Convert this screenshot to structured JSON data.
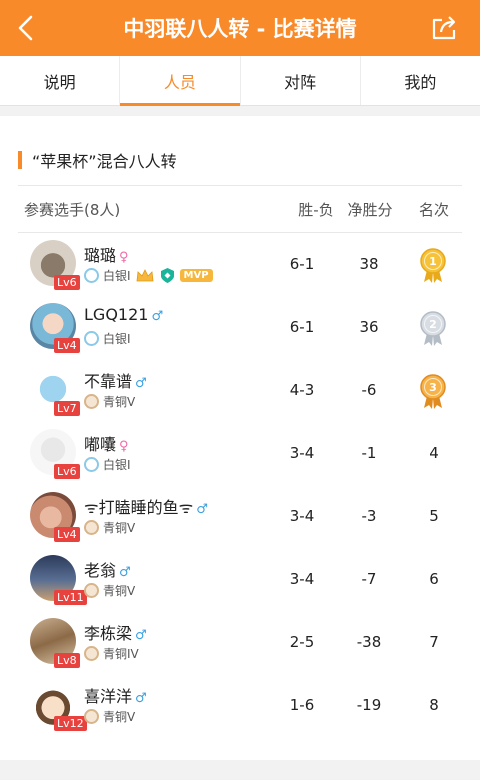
{
  "header": {
    "title": "中羽联八人转 - 比赛详情"
  },
  "tabs": [
    {
      "label": "说明"
    },
    {
      "label": "人员"
    },
    {
      "label": "对阵"
    },
    {
      "label": "我的"
    }
  ],
  "section": {
    "title": "“苹果杯”混合八人转"
  },
  "table": {
    "headers": {
      "player": "参赛选手(8人)",
      "wl": "胜-负",
      "net": "净胜分",
      "rank": "名次"
    },
    "rows": [
      {
        "name": "璐璐",
        "gender": "♀",
        "level": "Lv6",
        "tier": "白银I",
        "wl": "6-1",
        "net": "38",
        "rank": "1"
      },
      {
        "name": "LGQ121",
        "gender": "♂",
        "level": "Lv4",
        "tier": "白银I",
        "wl": "6-1",
        "net": "36",
        "rank": "2"
      },
      {
        "name": "不靠谱",
        "gender": "♂",
        "level": "Lv7",
        "tier": "青铜V",
        "wl": "4-3",
        "net": "-6",
        "rank": "3"
      },
      {
        "name": "嘟囔",
        "gender": "♀",
        "level": "Lv6",
        "tier": "白银I",
        "wl": "3-4",
        "net": "-1",
        "rank": "4"
      },
      {
        "name": "ᯤ打瞌睡的鱼ᯤ",
        "gender": "♂",
        "level": "Lv4",
        "tier": "青铜V",
        "wl": "3-4",
        "net": "-3",
        "rank": "5"
      },
      {
        "name": "老翁",
        "gender": "♂",
        "level": "Lv11",
        "tier": "青铜V",
        "wl": "3-4",
        "net": "-7",
        "rank": "6"
      },
      {
        "name": "李栋梁",
        "gender": "♂",
        "level": "Lv8",
        "tier": "青铜IV",
        "wl": "2-5",
        "net": "-38",
        "rank": "7"
      },
      {
        "name": "喜洋洋",
        "gender": "♂",
        "level": "Lv12",
        "tier": "青铜V",
        "wl": "1-6",
        "net": "-19",
        "rank": "8"
      }
    ]
  },
  "badges": {
    "mvp": "MVP"
  },
  "colors": {
    "accent": "#f88a2a",
    "level_badge": "#e8423f",
    "female": "#f06aa8",
    "male": "#3a9fe0"
  },
  "icons": {
    "back": "chevron-left-icon",
    "share": "share-icon",
    "crown": "crown-icon",
    "shield": "shield-icon"
  }
}
